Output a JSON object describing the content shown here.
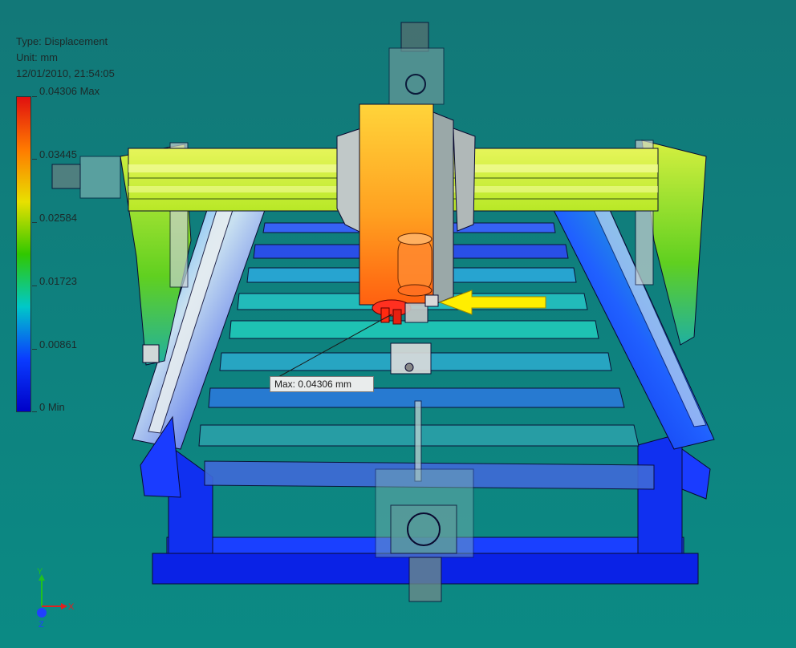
{
  "result_header": {
    "type_line": "Type: Displacement",
    "unit_line": "Unit: mm",
    "timestamp_line": "12/01/2010, 21:54:05"
  },
  "legend": {
    "levels": [
      "0.04306 Max",
      "0.03445",
      "0.02584",
      "0.01723",
      "0.00861",
      "0 Min"
    ],
    "colors": [
      "#e01010",
      "#ff7a00",
      "#e8e000",
      "#30c800",
      "#00c8c8",
      "#0a3cff",
      "#0000c8"
    ]
  },
  "probe": {
    "label": "Max: 0.04306 mm"
  },
  "triad": {
    "x_label": "X",
    "y_label": "Y",
    "z_label": "Z",
    "x_color": "#e02020",
    "y_color": "#20c020",
    "z_color": "#2040ff"
  },
  "icons": {
    "max_marker": "yellow-arrow-icon"
  }
}
